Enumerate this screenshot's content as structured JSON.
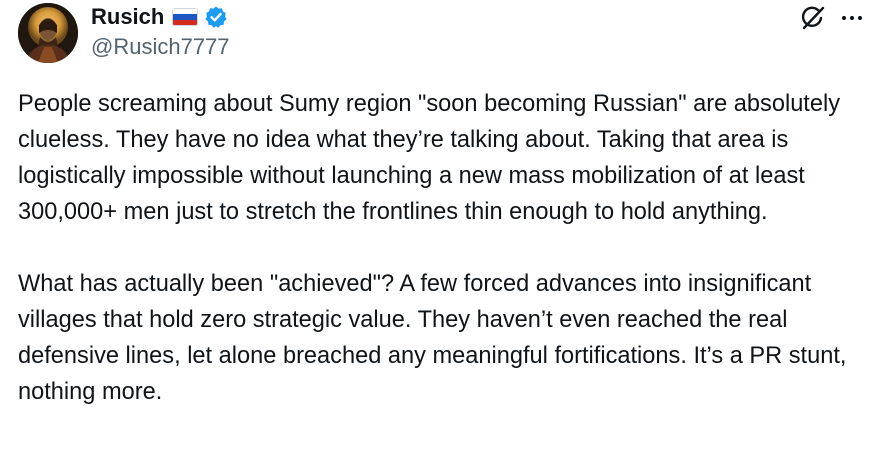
{
  "author": {
    "display_name": "Rusich",
    "flag": "russia-flag-icon",
    "verified": true,
    "handle": "@Rusich7777",
    "avatar": "avatar-icon"
  },
  "header_actions": {
    "grok": "grok-icon",
    "more": "more-icon"
  },
  "tweet": {
    "paragraph_1": "People screaming about Sumy region \"soon becoming Russian\" are absolutely clueless. They have no idea what they’re talking about. Taking that area is logistically impossible without launching a new mass mobilization of at least 300,000+ men just to stretch the frontlines thin enough to hold anything.",
    "paragraph_2": "What has actually been \"achieved\"? A few forced advances into insignificant villages that hold zero strategic value. They haven’t even reached the real defensive lines, let alone breached any meaningful fortifications. It’s a PR stunt, nothing more."
  },
  "colors": {
    "text": "#0f1419",
    "secondary_text": "#536471",
    "verified_blue": "#1d9bf0"
  }
}
